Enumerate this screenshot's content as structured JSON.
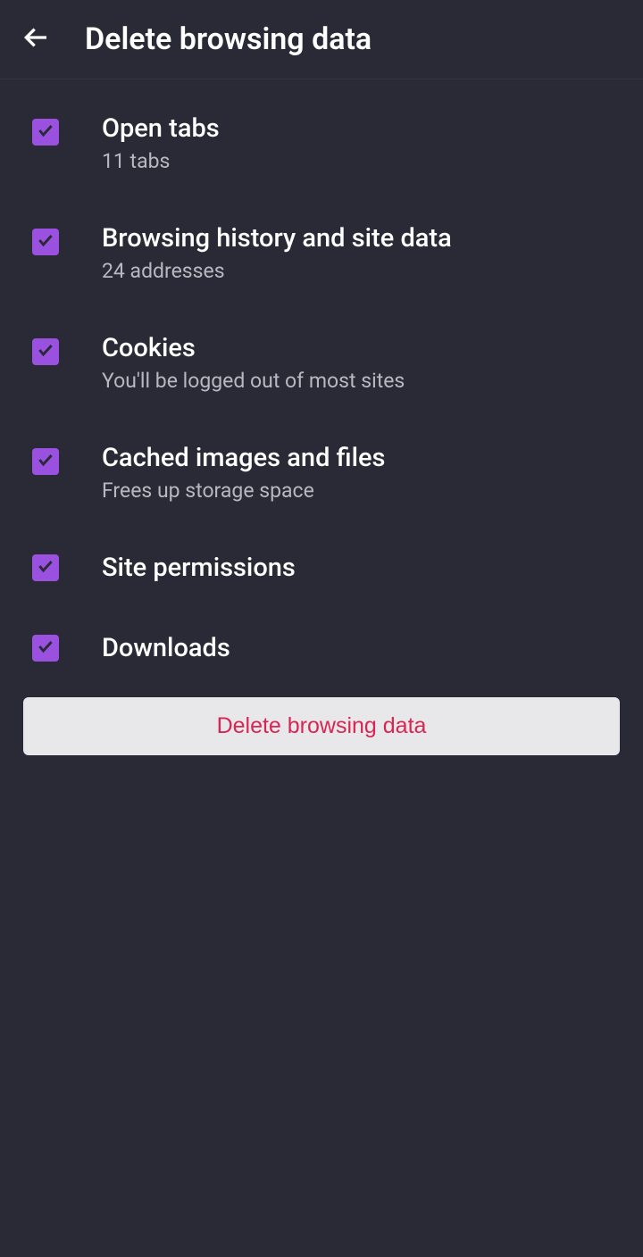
{
  "header": {
    "title": "Delete browsing data"
  },
  "options": {
    "open_tabs": {
      "title": "Open tabs",
      "subtitle": "11 tabs"
    },
    "browsing_history": {
      "title": "Browsing history and site data",
      "subtitle": "24 addresses"
    },
    "cookies": {
      "title": "Cookies",
      "subtitle": "You'll be logged out of most sites"
    },
    "cached": {
      "title": "Cached images and files",
      "subtitle": "Frees up storage space"
    },
    "site_permissions": {
      "title": "Site permissions"
    },
    "downloads": {
      "title": "Downloads"
    }
  },
  "delete_button_label": "Delete browsing data"
}
